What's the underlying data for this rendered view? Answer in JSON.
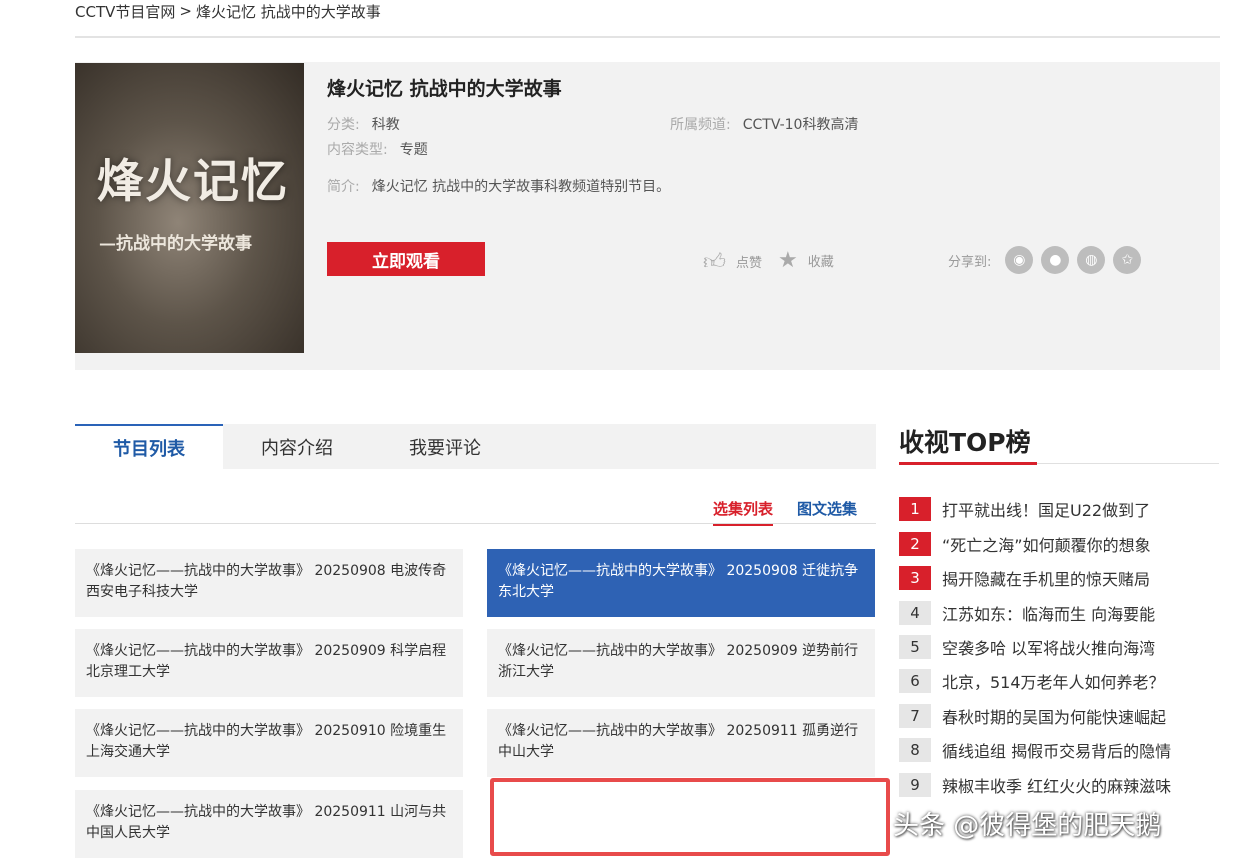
{
  "breadcrumb": {
    "home": "CCTV节目官网",
    "sep": ">",
    "current": "烽火记忆 抗战中的大学故事"
  },
  "poster": {
    "title": "烽火记忆",
    "subtitle": "—抗战中的大学故事"
  },
  "program": {
    "title": "烽火记忆 抗战中的大学故事",
    "category_label": "分类:",
    "category": "科教",
    "type_label": "内容类型:",
    "type": "专题",
    "channel_label": "所属频道:",
    "channel": "CCTV-10科教高清",
    "intro_label": "简介:",
    "intro": "烽火记忆 抗战中的大学故事科教频道特别节目。",
    "watch_label": "立即观看",
    "like_label": "点赞",
    "fav_label": "收藏",
    "share_label": "分享到:"
  },
  "tabs": [
    "节目列表",
    "内容介绍",
    "我要评论"
  ],
  "subtabs": {
    "selected": "选集列表",
    "other": "图文选集"
  },
  "episodes": [
    "《烽火记忆——抗战中的大学故事》 20250908 电波传奇 西安电子科技大学",
    "《烽火记忆——抗战中的大学故事》 20250908 迁徙抗争 东北大学",
    "《烽火记忆——抗战中的大学故事》 20250909 科学启程 北京理工大学",
    "《烽火记忆——抗战中的大学故事》 20250909 逆势前行 浙江大学",
    "《烽火记忆——抗战中的大学故事》 20250910 险境重生 上海交通大学",
    "《烽火记忆——抗战中的大学故事》 20250911 孤勇逆行 中山大学",
    "《烽火记忆——抗战中的大学故事》 20250911 山河与共 中国人民大学"
  ],
  "ranking": {
    "title": "收视TOP榜",
    "items": [
      {
        "num": "1",
        "text": "打平就出线！国足U22做到了"
      },
      {
        "num": "2",
        "text": "“死亡之海”如何颠覆你的想象"
      },
      {
        "num": "3",
        "text": "揭开隐藏在手机里的惊天赌局"
      },
      {
        "num": "4",
        "text": "江苏如东：临海而生 向海要能"
      },
      {
        "num": "5",
        "text": "空袭多哈 以军将战火推向海湾"
      },
      {
        "num": "6",
        "text": "北京，514万老年人如何养老？"
      },
      {
        "num": "7",
        "text": "春秋时期的吴国为何能快速崛起"
      },
      {
        "num": "8",
        "text": "循线追组 揭假币交易背后的隐情"
      },
      {
        "num": "9",
        "text": "辣椒丰收季 红红火火的麻辣滋味"
      }
    ]
  },
  "watermark": "头条 @彼得堡的肥天鹅",
  "colors": {
    "accent_red": "#d8202b",
    "accent_blue": "#2e62b4",
    "panel_gray": "#f2f2f2"
  }
}
